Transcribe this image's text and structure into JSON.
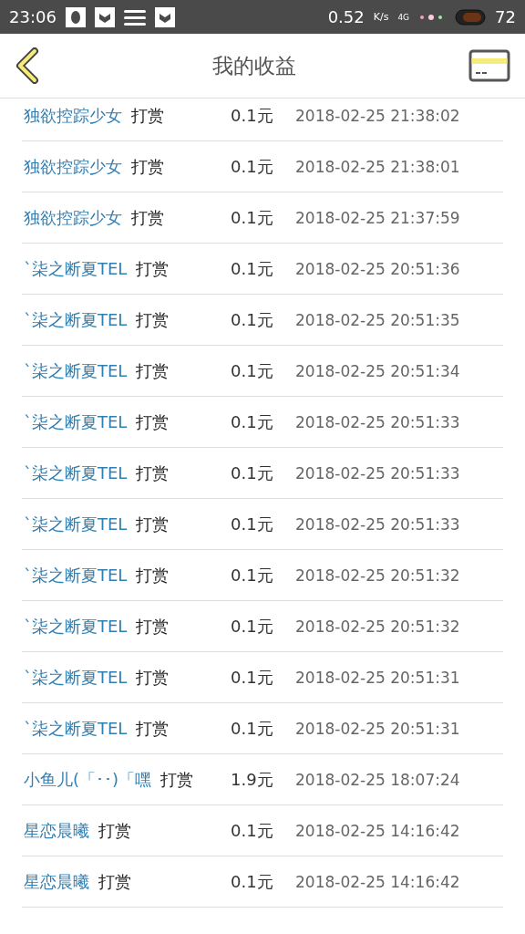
{
  "status_bar": {
    "time": "23:06",
    "speed": "0.52",
    "speed_unit": "K/s",
    "network": "4G",
    "battery": "72"
  },
  "header": {
    "title": "我的收益"
  },
  "rows": [
    {
      "name": "独欲控踪少女",
      "action": "打赏",
      "amount": "0.1元",
      "time": "2018-02-25 21:38:02"
    },
    {
      "name": "独欲控踪少女",
      "action": "打赏",
      "amount": "0.1元",
      "time": "2018-02-25 21:38:01"
    },
    {
      "name": "独欲控踪少女",
      "action": "打赏",
      "amount": "0.1元",
      "time": "2018-02-25 21:37:59"
    },
    {
      "name": "`柒之断夏TEL",
      "action": "打赏",
      "amount": "0.1元",
      "time": "2018-02-25 20:51:36"
    },
    {
      "name": "`柒之断夏TEL",
      "action": "打赏",
      "amount": "0.1元",
      "time": "2018-02-25 20:51:35"
    },
    {
      "name": "`柒之断夏TEL",
      "action": "打赏",
      "amount": "0.1元",
      "time": "2018-02-25 20:51:34"
    },
    {
      "name": "`柒之断夏TEL",
      "action": "打赏",
      "amount": "0.1元",
      "time": "2018-02-25 20:51:33"
    },
    {
      "name": "`柒之断夏TEL",
      "action": "打赏",
      "amount": "0.1元",
      "time": "2018-02-25 20:51:33"
    },
    {
      "name": "`柒之断夏TEL",
      "action": "打赏",
      "amount": "0.1元",
      "time": "2018-02-25 20:51:33"
    },
    {
      "name": "`柒之断夏TEL",
      "action": "打赏",
      "amount": "0.1元",
      "time": "2018-02-25 20:51:32"
    },
    {
      "name": "`柒之断夏TEL",
      "action": "打赏",
      "amount": "0.1元",
      "time": "2018-02-25 20:51:32"
    },
    {
      "name": "`柒之断夏TEL",
      "action": "打赏",
      "amount": "0.1元",
      "time": "2018-02-25 20:51:31"
    },
    {
      "name": "`柒之断夏TEL",
      "action": "打赏",
      "amount": "0.1元",
      "time": "2018-02-25 20:51:31"
    },
    {
      "name": "小鱼儿(「･･)「嘿",
      "action": "打赏",
      "amount": "1.9元",
      "time": "2018-02-25 18:07:24"
    },
    {
      "name": "星恋晨曦",
      "action": "打赏",
      "amount": "0.1元",
      "time": "2018-02-25 14:16:42"
    },
    {
      "name": "星恋晨曦",
      "action": "打赏",
      "amount": "0.1元",
      "time": "2018-02-25 14:16:42"
    }
  ]
}
